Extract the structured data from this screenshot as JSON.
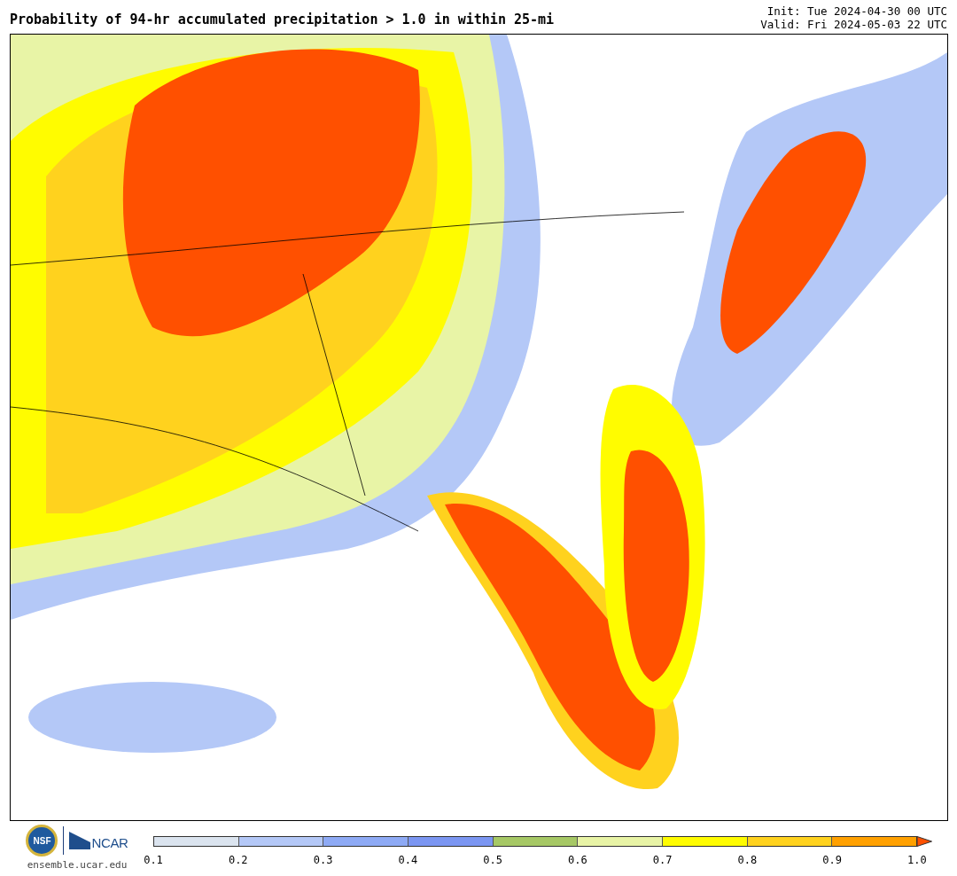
{
  "title": "Probability of 94-hr accumulated precipitation > 1.0 in within 25-mi",
  "init": "Init: Tue 2024-04-30 00 UTC",
  "valid": "Valid: Fri 2024-05-03 22 UTC",
  "logos": {
    "nsf": "NSF",
    "ncar": "NCAR",
    "site": "ensemble.ucar.edu"
  },
  "colorbar": {
    "bins": [
      {
        "color": "#dbe4ef"
      },
      {
        "color": "#b4c8f7"
      },
      {
        "color": "#8eaaf5"
      },
      {
        "color": "#7b96f2"
      },
      {
        "color": "#a6c865"
      },
      {
        "color": "#e8f4a6"
      },
      {
        "color": "#fffc00"
      },
      {
        "color": "#ffd21e"
      },
      {
        "color": "#ffa000"
      },
      {
        "color": "#ff5000",
        "kind": "arrow"
      }
    ],
    "ticks": [
      "0.1",
      "0.2",
      "0.3",
      "0.4",
      "0.5",
      "0.6",
      "0.7",
      "0.8",
      "0.9",
      "1.0"
    ]
  }
}
